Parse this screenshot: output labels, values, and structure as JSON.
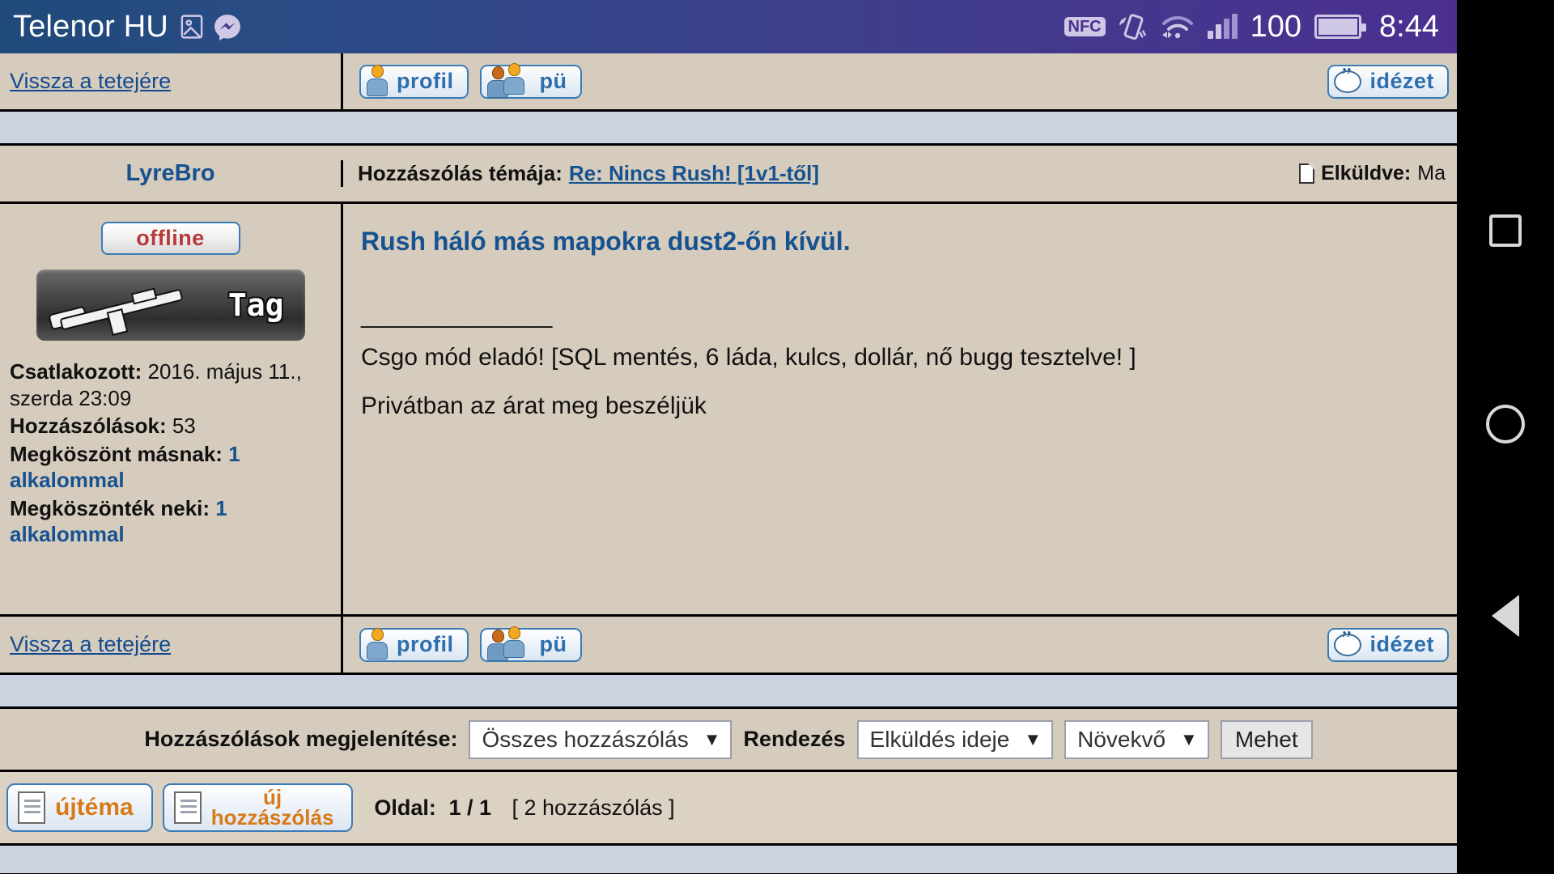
{
  "statusbar": {
    "carrier": "Telenor HU",
    "icons": [
      "photo-icon",
      "messenger-icon",
      "nfc-icon",
      "vibrate-icon",
      "wifi-icon",
      "signal-icon"
    ],
    "nfc_label": "NFC",
    "battery_percent": "100",
    "clock": "8:44"
  },
  "topbar": {
    "back_to_top": "Vissza a tetejére",
    "profile_button": "profil",
    "pm_button": "pü",
    "quote_button": "idézet"
  },
  "post": {
    "username": "LyreBro",
    "topic_label": "Hozzászólás témája:",
    "topic_value": "Re: Nincs Rush! [1v1-től]",
    "sent_label": "Elküldve:",
    "sent_value": "Ma",
    "status": "offline",
    "rank_tag": "Tag",
    "joined_label": "Csatlakozott:",
    "joined_value": "2016. május 11., szerda 23:09",
    "posts_label": "Hozzászólások:",
    "posts_value": "53",
    "thanked_label": "Megköszönt másnak:",
    "thanked_value": "1 alkalommal",
    "received_label": "Megköszönték neki:",
    "received_value": "1 alkalommal",
    "title": "Rush háló más mapokra dust2-őn kívül.",
    "separator": "_______________",
    "line1": "Csgo mód eladó! [SQL mentés, 6 láda, kulcs, dollár, nő bugg tesztelve! ]",
    "line2": "Privátban az árat meg beszéljük"
  },
  "bottombar": {
    "back_to_top": "Vissza a tetejére",
    "profile_button": "profil",
    "pm_button": "pü",
    "quote_button": "idézet"
  },
  "toolbar": {
    "display_label": "Hozzászólások megjelenítése:",
    "display_value": "Összes hozzászólás",
    "sort_label": "Rendezés",
    "sort_value": "Elküldés ideje",
    "order_value": "Növekvő",
    "go_button": "Mehet",
    "caret": "▼"
  },
  "footer": {
    "new_topic": "újtéma",
    "new_post_line1": "új",
    "new_post_line2": "hozzászólás",
    "page_label": "Oldal:",
    "page_value": "1 / 1",
    "post_count": "[ 2 hozzászólás ]"
  },
  "navbar": {
    "recents": "square-icon",
    "home": "circle-icon",
    "back": "triangle-back-icon"
  },
  "colors": {
    "accent_blue": "#16528f",
    "paper": "#d6ccbe",
    "band": "#cdd3e0",
    "orange": "#d77a18"
  }
}
